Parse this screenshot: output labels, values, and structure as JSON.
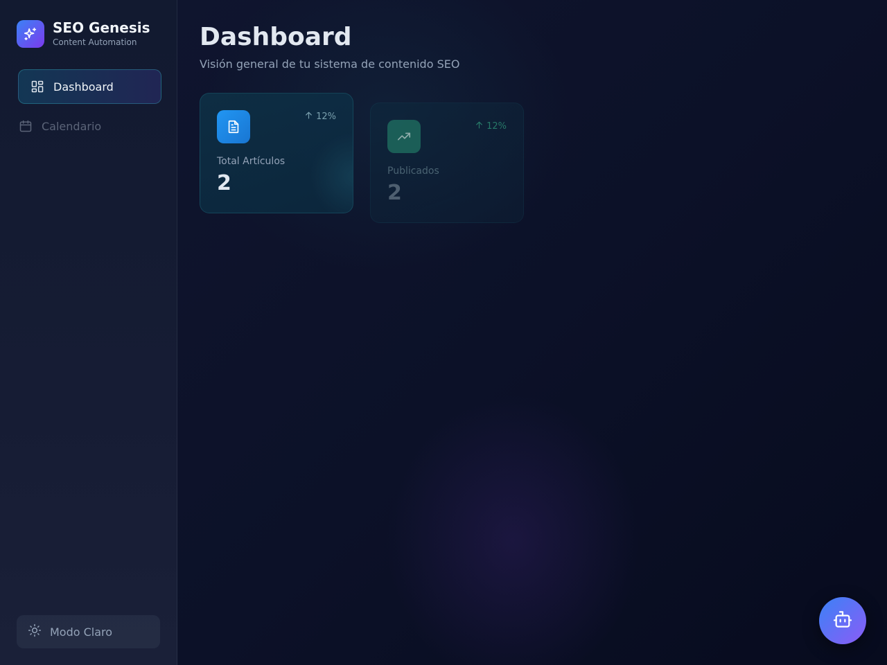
{
  "brand": {
    "title": "SEO Genesis",
    "subtitle": "Content Automation",
    "logo_icon": "sparkles-icon",
    "logo_colors": [
      "#3b82f6",
      "#7c3aed"
    ]
  },
  "sidebar": {
    "items": [
      {
        "label": "Dashboard",
        "icon": "layout-dashboard-icon",
        "active": true
      },
      {
        "label": "Calendario",
        "icon": "calendar-icon",
        "active": false
      }
    ],
    "theme_toggle": {
      "label": "Modo Claro",
      "icon": "sun-icon"
    }
  },
  "main": {
    "title": "Dashboard",
    "subtitle": "Visión general de tu sistema de contenido SEO",
    "cards": [
      {
        "label": "Total Artículos",
        "value": "2",
        "trend": "12%",
        "icon": "file-text-icon",
        "icon_color": "#2196f3"
      },
      {
        "label": "Publicados",
        "value": "2",
        "trend": "12%",
        "icon": "trending-up-icon",
        "icon_color": "#1e6a5e"
      }
    ]
  },
  "fab": {
    "icon": "bot-icon"
  },
  "colors": {
    "background": "#0b1024",
    "accent": "#3b82f6",
    "accent_secondary": "#8b5cf6",
    "positive_trend": "#2c8a72"
  }
}
